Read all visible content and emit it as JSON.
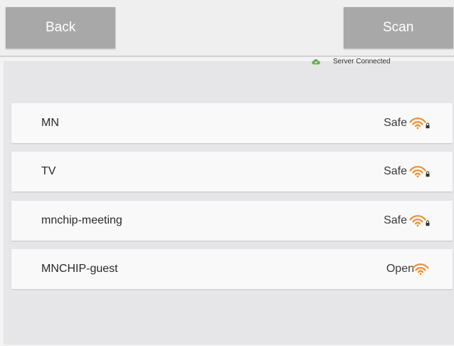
{
  "header": {
    "back_label": "Back",
    "scan_label": "Scan"
  },
  "status": {
    "text": "Server Connected",
    "icon": "cloud-icon",
    "color": "#63b04a"
  },
  "networks": [
    {
      "ssid": "MN",
      "security": "Safe",
      "icon": "wifi-locked-icon"
    },
    {
      "ssid": "TV",
      "security": "Safe",
      "icon": "wifi-locked-icon"
    },
    {
      "ssid": "mnchip-meeting",
      "security": "Safe",
      "icon": "wifi-locked-icon"
    },
    {
      "ssid": "MNCHIP-guest",
      "security": "Open",
      "icon": "wifi-icon"
    }
  ],
  "colors": {
    "button_bg": "#a8a8a8",
    "wifi_orange": "#f28c28"
  }
}
